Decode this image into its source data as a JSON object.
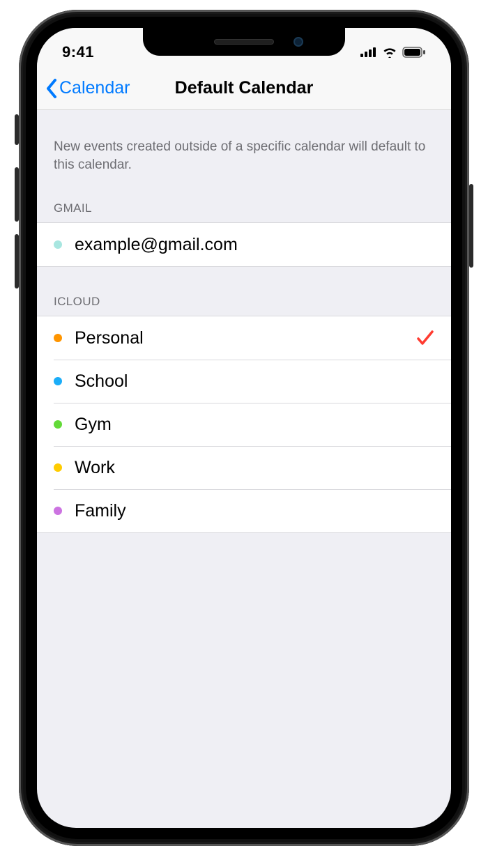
{
  "status": {
    "time": "9:41"
  },
  "nav": {
    "back_label": "Calendar",
    "title": "Default Calendar"
  },
  "description": "New events created outside of a specific calendar will default to this calendar.",
  "groups": [
    {
      "header": "GMAIL",
      "items": [
        {
          "label": "example@gmail.com",
          "color": "#a8e6e0",
          "selected": false
        }
      ]
    },
    {
      "header": "ICLOUD",
      "items": [
        {
          "label": "Personal",
          "color": "#ff9500",
          "selected": true
        },
        {
          "label": "School",
          "color": "#1badf8",
          "selected": false
        },
        {
          "label": "Gym",
          "color": "#63da38",
          "selected": false
        },
        {
          "label": "Work",
          "color": "#ffcc00",
          "selected": false
        },
        {
          "label": "Family",
          "color": "#cc73e1",
          "selected": false
        }
      ]
    }
  ],
  "colors": {
    "accent": "#007aff",
    "check": "#ff3b30"
  }
}
